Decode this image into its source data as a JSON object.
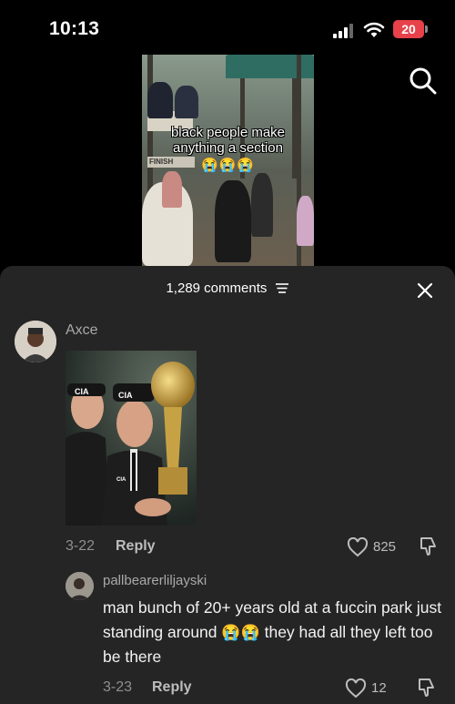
{
  "status_bar": {
    "time": "10:13",
    "battery": "20",
    "battery_color": "#e8414a"
  },
  "video": {
    "caption_line1": "black people make",
    "caption_line2": "anything a section",
    "caption_emojis": "😭😭😭",
    "sign_text": "FINISH"
  },
  "comments_sheet": {
    "comment_count": "1,289 comments",
    "filter_icon": "filter-lines-icon",
    "close_icon": "close-icon",
    "background": "#252525",
    "comment": {
      "username": "Axce",
      "image_caption": "CIA",
      "date": "3-22",
      "reply_label": "Reply",
      "likes": "825"
    },
    "reply": {
      "username": "pallbearerliljayski",
      "text_part1": "man bunch of 20+ years old at a fuccin park just standing around ",
      "emojis": "😭😭",
      "text_part2": " they had all they left too be there",
      "date": "3-23",
      "reply_label": "Reply",
      "likes": "12"
    }
  }
}
